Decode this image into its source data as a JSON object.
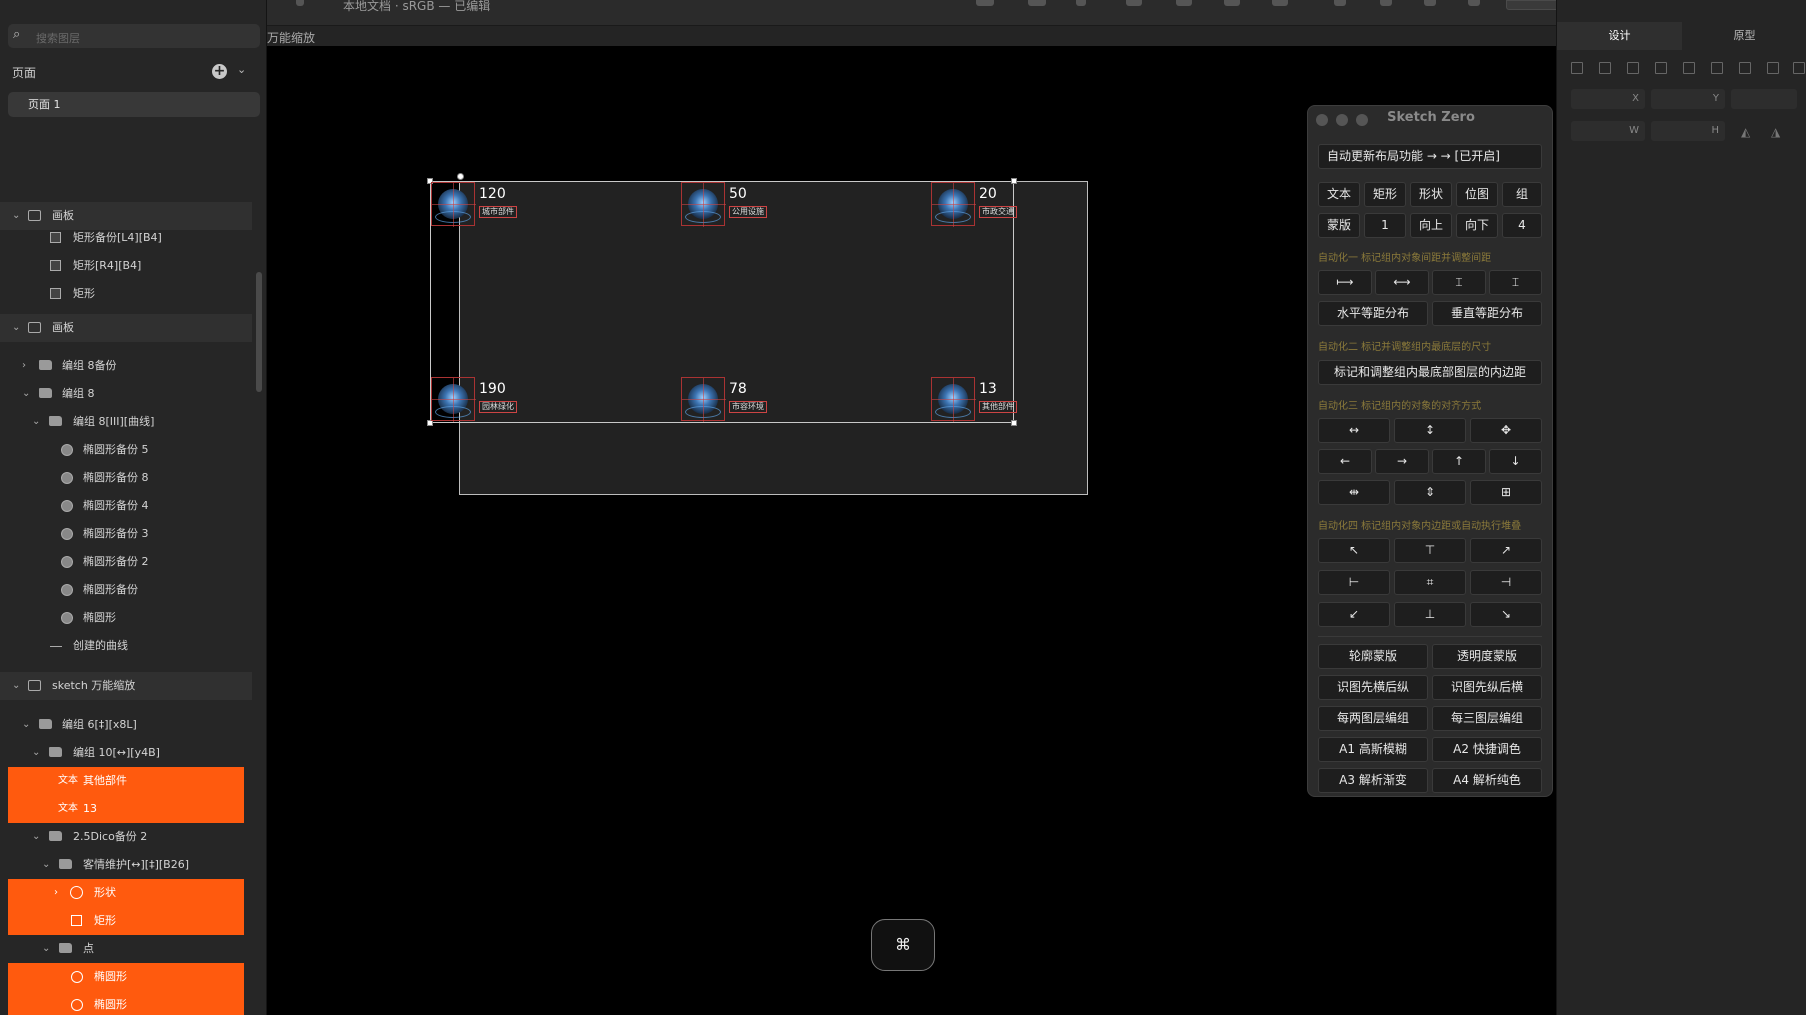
{
  "window": {
    "title": "本地文档 · sRGB — 已编辑"
  },
  "sidebar": {
    "search_placeholder": "搜索图层",
    "pages_label": "页面",
    "page_item": "页面 1",
    "layers": [
      {
        "label": "画板",
        "tag": ""
      },
      {
        "label": "矩形备份[L4][B4]",
        "tag": ""
      },
      {
        "label": "矩形[R4][B4]",
        "tag": ""
      },
      {
        "label": "矩形",
        "tag": ""
      },
      {
        "label": "画板",
        "tag": ""
      },
      {
        "label": "编组 8备份",
        "tag": ""
      },
      {
        "label": "编组 8",
        "tag": ""
      },
      {
        "label": "编组 8[III][曲线]",
        "tag": ""
      },
      {
        "label": "椭圆形备份 5",
        "tag": ""
      },
      {
        "label": "椭圆形备份 8",
        "tag": ""
      },
      {
        "label": "椭圆形备份 4",
        "tag": ""
      },
      {
        "label": "椭圆形备份 3",
        "tag": ""
      },
      {
        "label": "椭圆形备份 2",
        "tag": ""
      },
      {
        "label": "椭圆形备份",
        "tag": ""
      },
      {
        "label": "椭圆形",
        "tag": ""
      },
      {
        "label": "创建的曲线",
        "tag": ""
      },
      {
        "label": "sketch 万能缩放",
        "tag": ""
      },
      {
        "label": "编组 6[‡][x8L]",
        "tag": ""
      },
      {
        "label": "编组 10[↔][y4B]",
        "tag": ""
      },
      {
        "label": "其他部件",
        "tag": "文本"
      },
      {
        "label": "13",
        "tag": "文本"
      },
      {
        "label": "2.5Dico备份 2",
        "tag": ""
      },
      {
        "label": "客情维护[↔][‡][B26]",
        "tag": ""
      },
      {
        "label": "形状",
        "tag": ""
      },
      {
        "label": "矩形",
        "tag": ""
      },
      {
        "label": "点",
        "tag": ""
      },
      {
        "label": "椭圆形",
        "tag": ""
      },
      {
        "label": "椭圆形",
        "tag": ""
      }
    ]
  },
  "canvas": {
    "artboard_title": "万能缩放",
    "tiles": [
      {
        "value": "120",
        "label": "城市部件"
      },
      {
        "value": "50",
        "label": "公用设施"
      },
      {
        "value": "20",
        "label": "市政交通"
      },
      {
        "value": "190",
        "label": "园林绿化"
      },
      {
        "value": "78",
        "label": "市容环境"
      },
      {
        "value": "13",
        "label": "其他部件"
      }
    ],
    "cmd_key": "⌘"
  },
  "plugin": {
    "title": "Sketch Zero",
    "auto_update": "自动更新布局功能 → → [已开启]",
    "row1": [
      "文本",
      "矩形",
      "形状",
      "位图",
      "组"
    ],
    "row2": [
      "蒙版",
      "1",
      "向上",
      "向下",
      "4"
    ],
    "sec1": "自动化一 标记组内对象间距并调整间距",
    "spacing_icons": [
      "⟼",
      "⟷",
      "⌶",
      "⌶"
    ],
    "dist_h": "水平等距分布",
    "dist_v": "垂直等距分布",
    "sec2": "自动化二 标记并调整组内最底层的尺寸",
    "padding_btn": "标记和调整组内最底部图层的内边距",
    "sec3": "自动化三 标记组内的对象的对齐方式",
    "align_rows": [
      [
        "↔",
        "↕",
        "✥"
      ],
      [
        "←",
        "→",
        "↑",
        "↓"
      ],
      [
        "⇹",
        "⇕",
        "⊞"
      ]
    ],
    "sec4": "自动化四 标记组内对象内边距或自动执行堆叠",
    "pos_rows": [
      [
        "↖",
        "⊤",
        "↗"
      ],
      [
        "⊢",
        "⌗",
        "⊣"
      ],
      [
        "↙",
        "⊥",
        "↘"
      ]
    ],
    "bottom_rows": [
      [
        "轮廓蒙版",
        "透明度蒙版"
      ],
      [
        "识图先横后纵",
        "识图先纵后横"
      ],
      [
        "每两图层编组",
        "每三图层编组"
      ],
      [
        "A1 高斯模糊",
        "A2 快捷调色"
      ],
      [
        "A3 解析渐变",
        "A4 解析纯色"
      ]
    ]
  },
  "inspector": {
    "tab_design": "设计",
    "tab_prototype": "原型",
    "x_label": "X",
    "y_label": "Y",
    "w_label": "W",
    "h_label": "H"
  },
  "colors": {
    "accent": "#ff5a0e",
    "selection": "#ff5a0e"
  }
}
